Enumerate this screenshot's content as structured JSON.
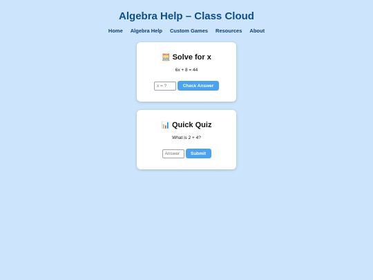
{
  "header": {
    "title": "Algebra Help – Class Cloud"
  },
  "nav": {
    "items": [
      {
        "label": "Home"
      },
      {
        "label": "Algebra Help"
      },
      {
        "label": "Custom Games"
      },
      {
        "label": "Resources"
      },
      {
        "label": "About"
      }
    ]
  },
  "cards": [
    {
      "icon": "abacus-icon",
      "icon_glyph": "🧮",
      "title": "Solve for x",
      "text": "6x + 8 = 44",
      "input_placeholder": "x = ?",
      "input_value": "",
      "button_label": "Check Answer"
    },
    {
      "icon": "bar-chart-icon",
      "icon_glyph": "📊",
      "title": "Quick Quiz",
      "text": "What is 2 + 4?",
      "input_placeholder": "Answer",
      "input_value": "",
      "button_label": "Submit"
    }
  ],
  "colors": {
    "background": "#cce5fc",
    "title": "#0b4f8a",
    "nav": "#0b3f70",
    "button": "#4aa3f0"
  }
}
